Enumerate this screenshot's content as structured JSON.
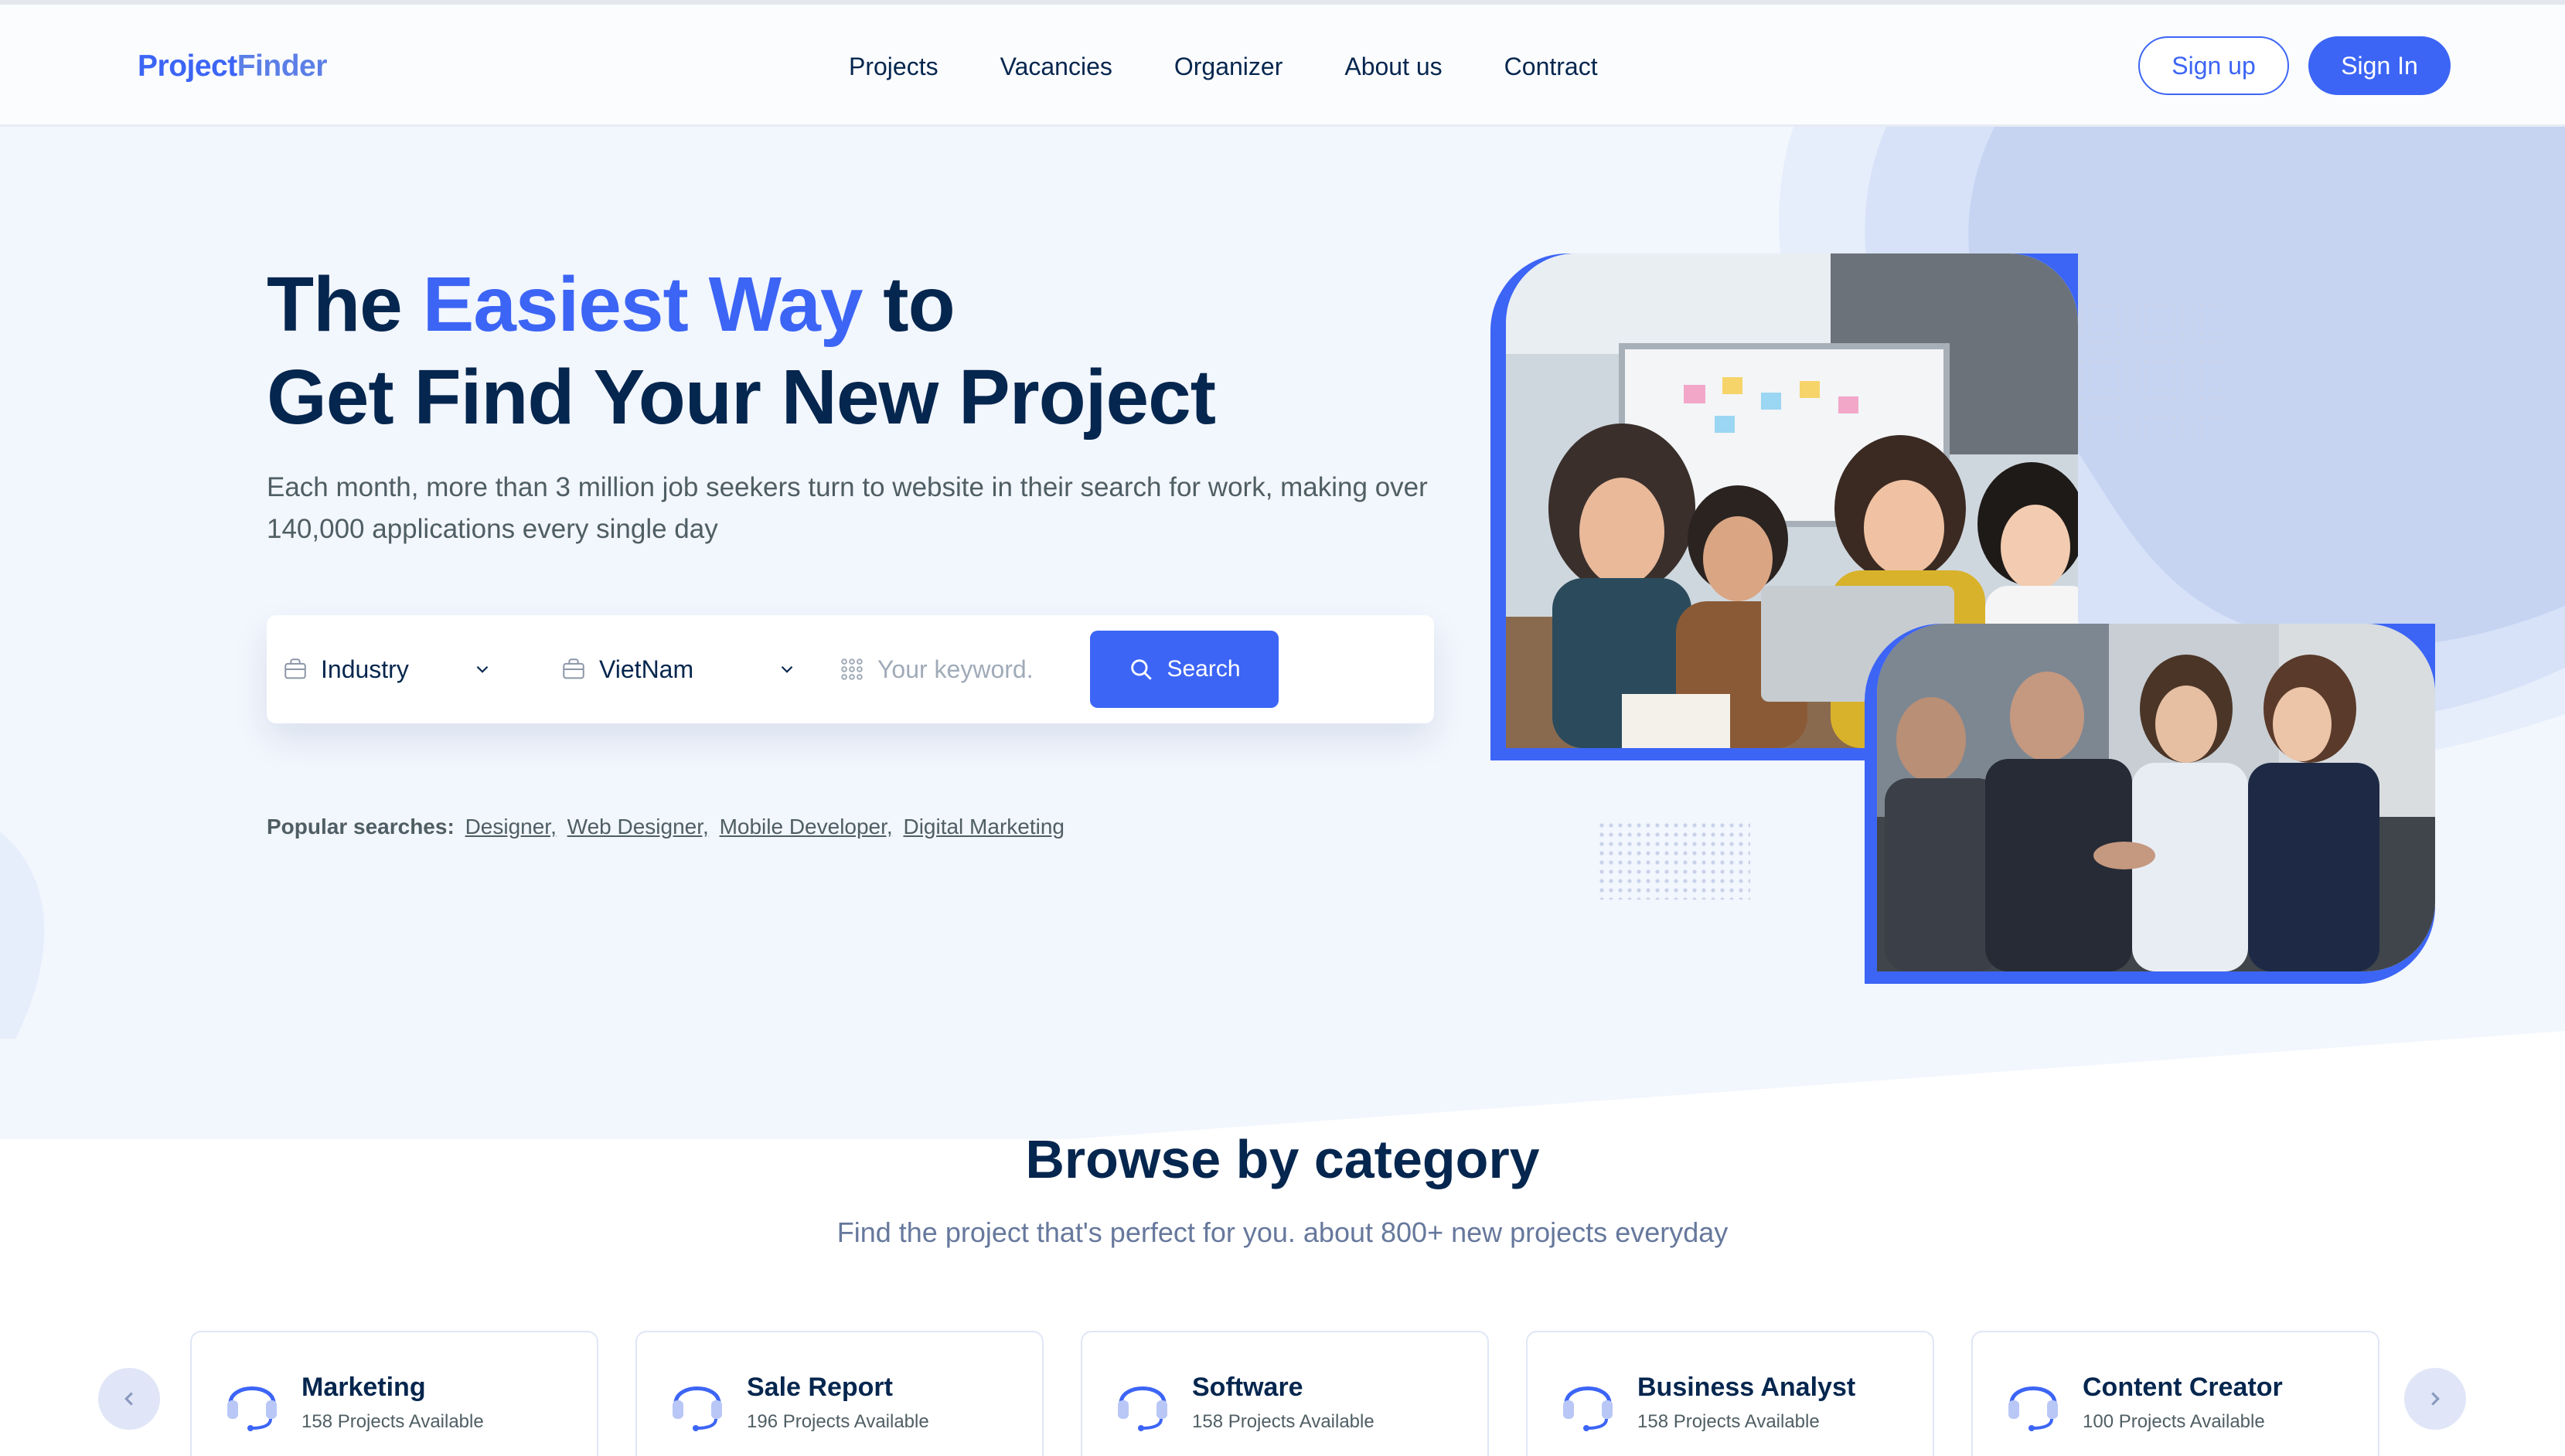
{
  "header": {
    "logo_part1": "Project",
    "logo_part2": "Finder",
    "nav": [
      "Projects",
      "Vacancies",
      "Organizer",
      "About us",
      "Contract"
    ],
    "signup_label": "Sign up",
    "signin_label": "Sign In"
  },
  "hero": {
    "title_pre": "The ",
    "title_highlight": "Easiest Way",
    "title_post": " to",
    "title_line2": "Get Find Your New Project",
    "lead": "Each month, more than 3 million job seekers turn to website in their search for work, making over 140,000 applications every single day",
    "search": {
      "industry_value": "Industry",
      "location_value": "VietNam",
      "keyword_placeholder": "Your keyword.",
      "button_label": "Search"
    },
    "popular_label": "Popular searches:",
    "popular_items": [
      "Designer,",
      "Web Designer,",
      "Mobile Developer,",
      "Digital Marketing"
    ]
  },
  "category": {
    "title": "Browse by category",
    "subtitle": "Find the project that's perfect for you. about 800+ new projects everyday",
    "cards": [
      {
        "title": "Marketing",
        "count": "158 Projects Available"
      },
      {
        "title": "Sale Report",
        "count": "196 Projects Available"
      },
      {
        "title": "Software",
        "count": "158 Projects Available"
      },
      {
        "title": "Business Analyst",
        "count": "158 Projects Available"
      },
      {
        "title": "Content Creator",
        "count": "100 Projects Available"
      }
    ]
  },
  "colors": {
    "brand": "#3c65f5",
    "heading": "#05264e",
    "hero_bg": "#f2f6fd"
  },
  "icons": {
    "prev": "chevron-left-icon",
    "next": "chevron-right-icon",
    "category": "headset-icon",
    "search": "search-icon",
    "industry": "briefcase-icon",
    "location": "location-icon",
    "keyword": "grid-dots-icon"
  }
}
